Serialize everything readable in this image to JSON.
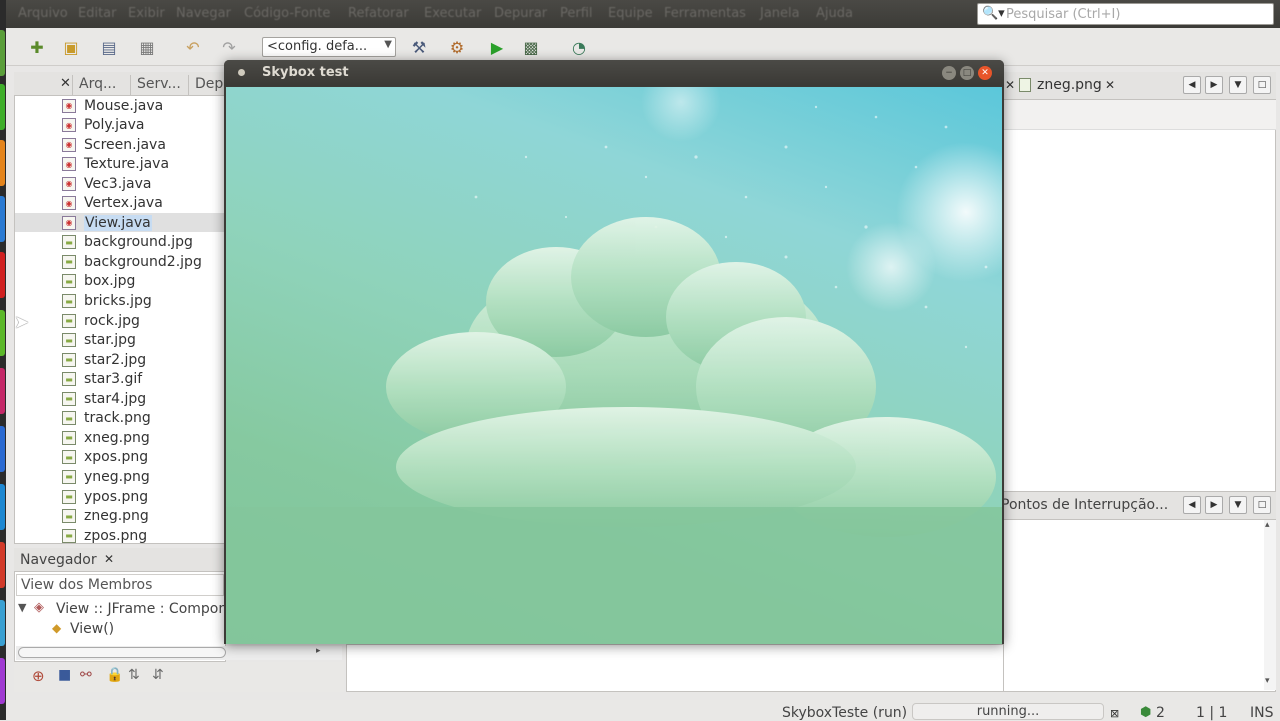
{
  "menubar": {
    "items": [
      "Arquivo",
      "Editar",
      "Exibir",
      "Navegar",
      "Código-Fonte",
      "Refatorar",
      "Executar",
      "Depurar",
      "Perfil",
      "Equipe",
      "Ferramentas",
      "Janela",
      "Ajuda"
    ],
    "search_placeholder": "Pesquisar (Ctrl+I)"
  },
  "toolbar": {
    "config_value": "<config. defa...",
    "icons": [
      "new-file-icon",
      "new-project-icon",
      "open-project-icon",
      "close-project-icon",
      "undo-icon",
      "redo-icon",
      "build-icon",
      "clean-build-icon",
      "run-icon",
      "debug-icon",
      "profile-icon"
    ]
  },
  "projects": {
    "tabs": [
      "Arq...",
      "Serv...",
      "Dep"
    ],
    "files": [
      {
        "name": "Mouse.java",
        "type": "java"
      },
      {
        "name": "Poly.java",
        "type": "java"
      },
      {
        "name": "Screen.java",
        "type": "java"
      },
      {
        "name": "Texture.java",
        "type": "java"
      },
      {
        "name": "Vec3.java",
        "type": "java"
      },
      {
        "name": "Vertex.java",
        "type": "java"
      },
      {
        "name": "View.java",
        "type": "java",
        "selected": true
      },
      {
        "name": "background.jpg",
        "type": "image"
      },
      {
        "name": "background2.jpg",
        "type": "image"
      },
      {
        "name": "box.jpg",
        "type": "image"
      },
      {
        "name": "bricks.jpg",
        "type": "image"
      },
      {
        "name": "rock.jpg",
        "type": "image"
      },
      {
        "name": "star.jpg",
        "type": "image"
      },
      {
        "name": "star2.jpg",
        "type": "image"
      },
      {
        "name": "star3.gif",
        "type": "image"
      },
      {
        "name": "star4.jpg",
        "type": "image"
      },
      {
        "name": "track.png",
        "type": "image"
      },
      {
        "name": "xneg.png",
        "type": "image"
      },
      {
        "name": "xpos.png",
        "type": "image"
      },
      {
        "name": "yneg.png",
        "type": "image"
      },
      {
        "name": "ypos.png",
        "type": "image"
      },
      {
        "name": "zneg.png",
        "type": "image"
      },
      {
        "name": "zpos.png",
        "type": "image"
      }
    ]
  },
  "navigator": {
    "title": "Navegador",
    "filter": "View dos Membros",
    "tree": [
      {
        "label": "View :: JFrame : Compon"
      },
      {
        "label": "View()"
      }
    ]
  },
  "editor": {
    "tab": "zneg.png"
  },
  "breakpoints": {
    "title": "Pontos de Interrupção..."
  },
  "skybox_window": {
    "title": "Skybox test"
  },
  "status": {
    "task": "SkyboxTeste (run)",
    "progress_label": "running...",
    "notifications": "2",
    "position": "1 | 1",
    "mode": "INS"
  },
  "colors": {
    "sky_top": "#5bc7da",
    "cloud_green": "#86c9a0",
    "selection": "#c7dcf2"
  }
}
